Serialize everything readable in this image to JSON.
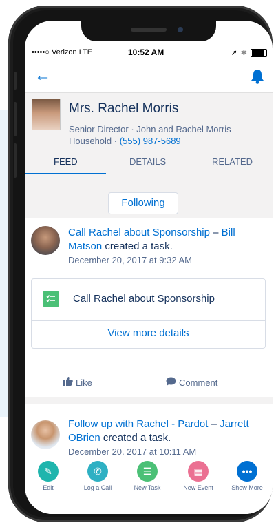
{
  "status": {
    "carrier": "•••••○ Verizon  LTE",
    "time": "10:52 AM"
  },
  "record": {
    "name": "Mrs. Rachel Morris",
    "title": "Senior Director",
    "account": "John and Rachel Morris Household",
    "phone": "(555) 987-5689",
    "separator": "·"
  },
  "tabs": {
    "feed": "FEED",
    "details": "DETAILS",
    "related": "RELATED"
  },
  "following_label": "Following",
  "feed": [
    {
      "link": "Call Rachel about Sponsorship",
      "dash": "–",
      "author": "Bill Matson",
      "action": "created a task.",
      "date": "December 20, 2017 at 9:32 AM"
    },
    {
      "link": "Follow up with Rachel - Pardot",
      "dash": "–",
      "author": "Jarrett OBrien",
      "action": "created a task.",
      "date": "December 20, 2017 at 10:11 AM"
    }
  ],
  "task_card": {
    "icon": "task-icon",
    "title": "Call Rachel about Sponsorship",
    "more": "View more details"
  },
  "actions": {
    "like": "Like",
    "comment": "Comment"
  },
  "bottom_actions": [
    {
      "label": "Edit",
      "icon": "edit-icon",
      "color": "#1fb5ad"
    },
    {
      "label": "Log a Call",
      "icon": "log-call-icon",
      "color": "#2eb0c3"
    },
    {
      "label": "New Task",
      "icon": "new-task-icon",
      "color": "#4bc076"
    },
    {
      "label": "New Event",
      "icon": "new-event-icon",
      "color": "#eb7092"
    },
    {
      "label": "Show More",
      "icon": "more-icon",
      "color": "#0070d2"
    }
  ],
  "colors": {
    "accent": "#0070d2",
    "text": "#16325c",
    "muted": "#54698d"
  }
}
